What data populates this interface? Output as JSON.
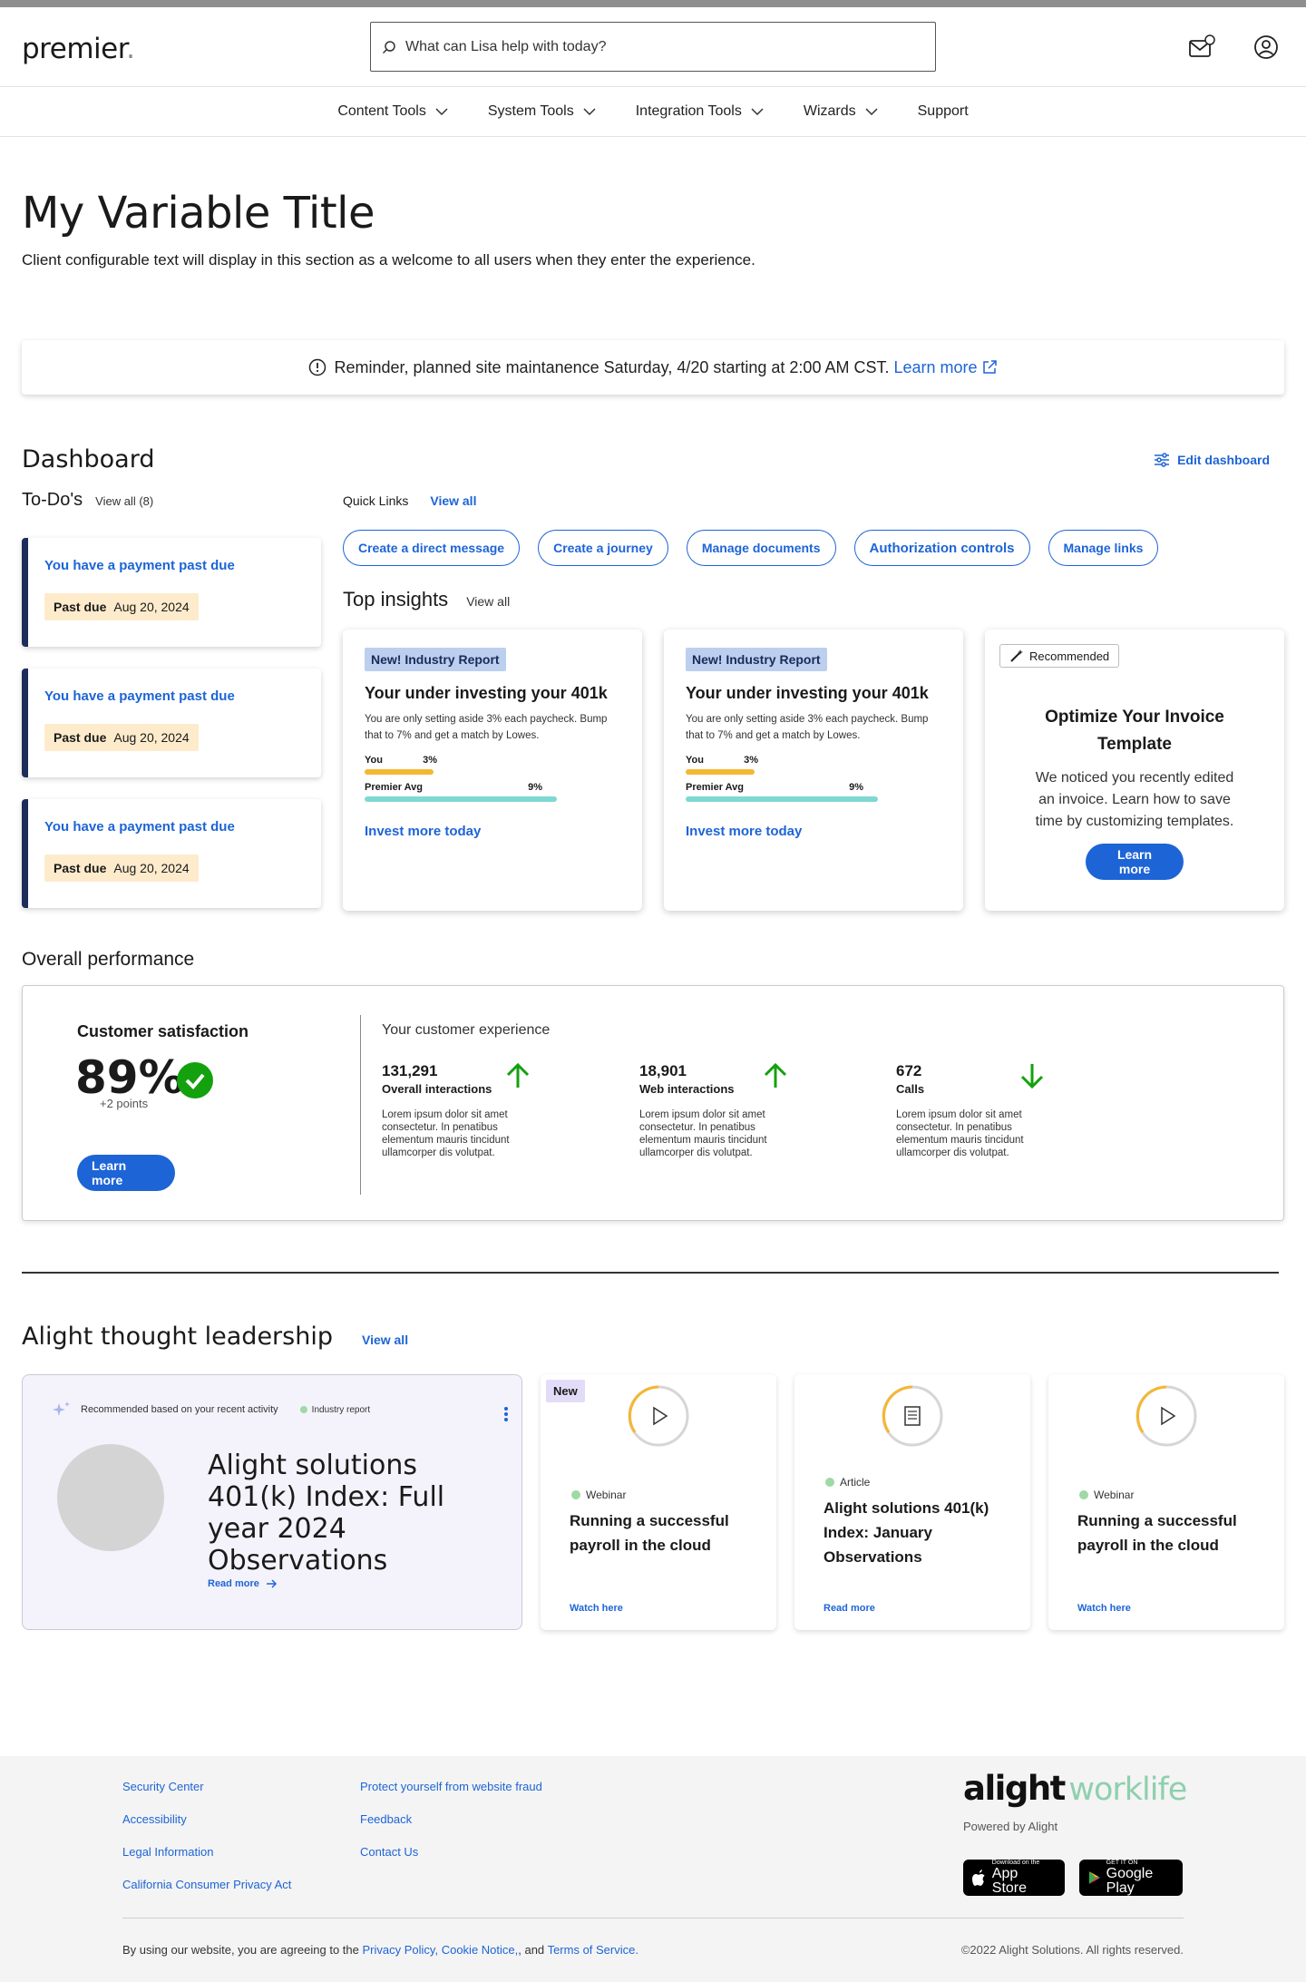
{
  "header": {
    "logo": "premier",
    "logo_dot": ".",
    "search_placeholder": "What can Lisa help with today?"
  },
  "nav": [
    {
      "label": "Content Tools",
      "dropdown": true
    },
    {
      "label": "System Tools",
      "dropdown": true
    },
    {
      "label": "Integration Tools",
      "dropdown": true
    },
    {
      "label": "Wizards",
      "dropdown": true
    },
    {
      "label": "Support",
      "dropdown": false
    }
  ],
  "page": {
    "title": "My Variable Title",
    "welcome": "Client configurable text will display in this section as a welcome to all users when they enter the experience."
  },
  "banner": {
    "text": "Reminder, planned site maintanence Saturday, 4/20 starting at 2:00 AM CST.",
    "link": "Learn more"
  },
  "dashboard": {
    "title": "Dashboard",
    "edit_label": "Edit dashboard"
  },
  "todos": {
    "title": "To-Do's",
    "view_all": "View all (8)",
    "items": [
      {
        "title": "You have a payment past due",
        "status": "Past due",
        "date": "Aug 20, 2024"
      },
      {
        "title": "You have a payment past due",
        "status": "Past due",
        "date": "Aug 20, 2024"
      },
      {
        "title": "You have a payment past due",
        "status": "Past due",
        "date": "Aug 20, 2024"
      }
    ]
  },
  "quick_links": {
    "title": "Quick Links",
    "view_all": "View all",
    "items": [
      "Create a direct message",
      "Create a journey",
      "Manage documents",
      "Authorization controls",
      "Manage links"
    ]
  },
  "insights": {
    "title": "Top insights",
    "view_all": "View all",
    "cards": [
      {
        "badge": "New! Industry Report",
        "title": "Your under investing your 401k",
        "desc": "You are only setting aside 3% each paycheck. Bump that to 7% and get a match by Lowes.",
        "you_label": "You",
        "you_value": "3%",
        "avg_label": "Premier Avg",
        "avg_value": "9%",
        "link": "Invest more today"
      },
      {
        "badge": "New! Industry Report",
        "title": "Your under investing your 401k",
        "desc": "You are only setting aside 3% each paycheck. Bump that to 7% and get a match by Lowes.",
        "you_label": "You",
        "you_value": "3%",
        "avg_label": "Premier Avg",
        "avg_value": "9%",
        "link": "Invest more today"
      }
    ],
    "recommended": {
      "badge": "Recommended",
      "title": "Optimize Your Invoice Template",
      "text": "We noticed you recently edited an invoice. Learn how to save time by customizing templates.",
      "button": "Learn more"
    }
  },
  "performance": {
    "title": "Overall performance",
    "cs_title": "Customer satisfaction",
    "cs_value": "89%",
    "cs_points": "+2 points",
    "cs_button": "Learn more",
    "ce_title": "Your customer experience",
    "metrics": [
      {
        "value": "131,291",
        "label": "Overall interactions",
        "trend": "up",
        "desc": "Lorem ipsum dolor sit amet consectetur. In penatibus elementum mauris tincidunt ullamcorper dis volutpat."
      },
      {
        "value": "18,901",
        "label": "Web interactions",
        "trend": "up",
        "desc": "Lorem ipsum dolor sit amet consectetur. In penatibus elementum mauris tincidunt ullamcorper dis volutpat."
      },
      {
        "value": "672",
        "label": "Calls",
        "trend": "down",
        "desc": "Lorem ipsum dolor sit amet consectetur. In penatibus elementum mauris tincidunt ullamcorper dis volutpat."
      }
    ]
  },
  "leadership": {
    "title": "Alight thought leadership",
    "view_all": "View all",
    "feature": {
      "recommended": "Recommended based on your recent activity",
      "tag": "Industry report",
      "title": "Alight solutions 401(k) Index: Full year 2024 Observations",
      "link": "Read more"
    },
    "cards": [
      {
        "badge": "New",
        "icon": "play-icon",
        "type": "Webinar",
        "title": "Running a successful payroll in the cloud",
        "link": "Watch here"
      },
      {
        "badge": "",
        "icon": "document-icon",
        "type": "Article",
        "title": "Alight solutions 401(k) Index: January Observations",
        "link": "Read more"
      },
      {
        "badge": "",
        "icon": "play-icon",
        "type": "Webinar",
        "title": "Running a successful payroll in the cloud",
        "link": "Watch here"
      }
    ]
  },
  "footer": {
    "col1": [
      "Security Center",
      "Accessibility",
      "Legal Information",
      "California Consumer Privacy Act"
    ],
    "col2": [
      "Protect yourself from website fraud",
      "Feedback",
      "Contact Us"
    ],
    "brand_a": "alight",
    "brand_b": "worklife",
    "powered": "Powered by Alight",
    "appstore_small": "Download on the",
    "appstore_big": "App Store",
    "gplay_small": "GET IT ON",
    "gplay_big": "Google Play",
    "agree_prefix": "By using our website, you are agreeing to the",
    "privacy": "Privacy Policy,",
    "cookie": "Cookie Notice,",
    "and": ", and",
    "terms": "Terms of Service.",
    "copyright": "©2022 Alight Solutions. All rights reserved."
  },
  "colors": {
    "accent": "#1d64d6",
    "todo_border": "#1d2d5a",
    "past_due_bg": "#fdebcc",
    "success": "#13a10e",
    "you_bar": "#f5b731",
    "avg_bar": "#7fd8d2"
  }
}
